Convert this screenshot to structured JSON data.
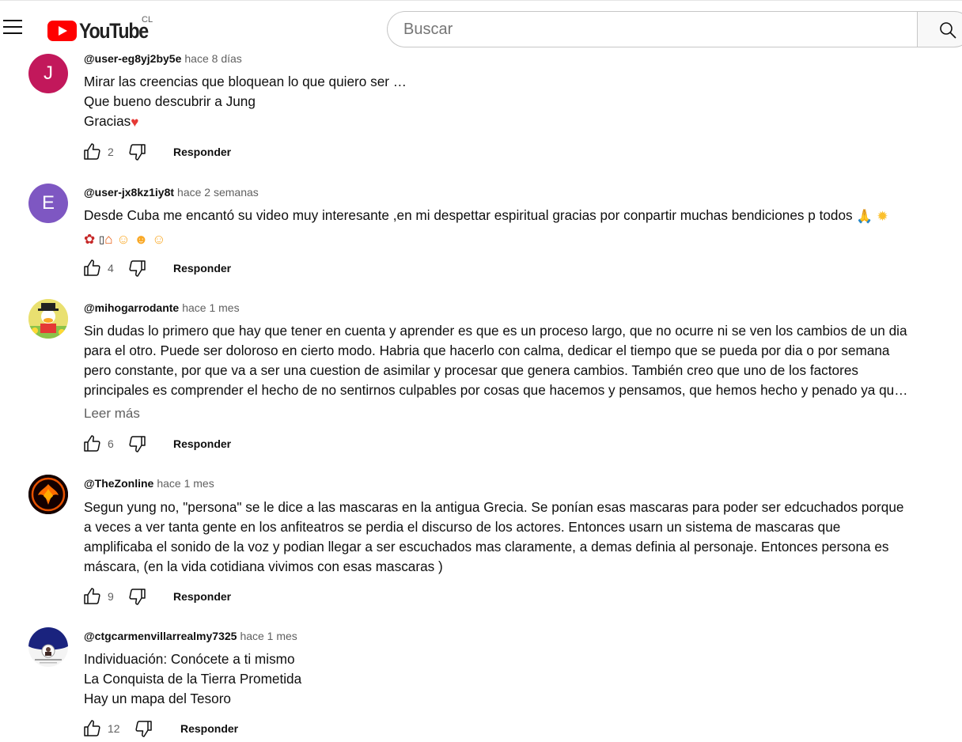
{
  "header": {
    "logo_text": "YouTube",
    "country": "CL",
    "search_placeholder": "Buscar"
  },
  "comments": [
    {
      "author": "@user-eg8yj2by5e",
      "time": "hace 8 días",
      "avatar_letter": "J",
      "avatar_color": "#c2185b",
      "lines": [
        "Mirar las creencias que bloquean lo que quiero ser …",
        "Que bueno descubrir a Jung",
        "Gracias"
      ],
      "likes": "2",
      "reply_label": "Responder"
    },
    {
      "author": "@user-jx8kz1iy8t",
      "time": "hace 2 semanas",
      "avatar_letter": "E",
      "avatar_color": "#7e57c2",
      "lines": [
        "Desde Cuba me encantó su video muy interesante ,en mi despettar espiritual gracias por conpartir muchas bendiciones p todos"
      ],
      "likes": "4",
      "reply_label": "Responder"
    },
    {
      "author": "@mihogarrodante",
      "time": "hace 1 mes",
      "lines": [
        "Sin dudas lo primero que hay que tener en cuenta y aprender es que es un proceso largo, que no ocurre ni se ven los cambios de un dia",
        "para el otro. Puede ser doloroso en cierto modo. Habria que hacerlo con calma, dedicar el tiempo que se pueda por dia o por semana",
        "pero constante, por que va a ser una cuestion de asimilar y procesar que genera cambios. También creo que uno de los factores",
        "principales es comprender el hecho de no sentirnos culpables por cosas que hacemos y pensamos, que hemos hecho y penado ya qu…"
      ],
      "read_more": "Leer más",
      "likes": "6",
      "reply_label": "Responder"
    },
    {
      "author": "@TheZonline",
      "time": "hace 1 mes",
      "lines": [
        "Segun yung no, \"persona\" se le dice a las mascaras en la antigua Grecia. Se ponían esas mascaras para poder ser edcuchados porque",
        "a veces a ver tanta gente en los anfiteatros se perdia el discurso de los actores. Entonces usarn un sistema de mascaras que",
        "amplificaba el sonido de la voz y podian llegar a ser escuchados mas claramente, a demas definia al personaje. Entonces persona es",
        "máscara, (en la vida cotidiana vivimos con esas mascaras )"
      ],
      "likes": "9",
      "reply_label": "Responder"
    },
    {
      "author": "@ctgcarmenvillarrealmy7325",
      "time": "hace 1 mes",
      "lines": [
        "Individuación: Conócete a ti mismo",
        "La Conquista de la Tierra Prometida",
        "Hay un mapa del Tesoro"
      ],
      "likes": "12",
      "reply_label": "Responder"
    }
  ]
}
